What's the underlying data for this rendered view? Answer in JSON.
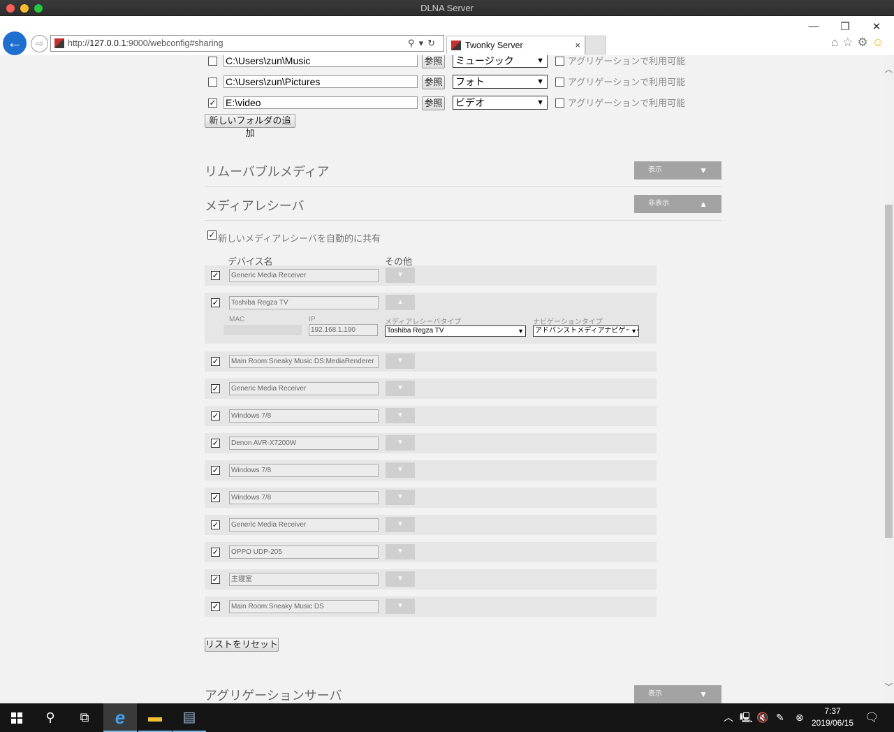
{
  "window": {
    "title": "DLNA Server"
  },
  "browser": {
    "url_prefix": "http://",
    "url_host": "127.0.0.1",
    "url_rest": ":9000/webconfig#sharing",
    "tab_title": "Twonky Server",
    "tab_close": "×",
    "win_min": "—",
    "win_restore": "❐",
    "win_close": "✕",
    "back_glyph": "←",
    "fwd_glyph": "⇨",
    "addr_icons": "⚲▾↻",
    "tool_home": "⌂",
    "tool_star": "☆",
    "tool_gear": "⚙",
    "tool_smile": "☺"
  },
  "folders": {
    "browse_label": "参照",
    "aggregation_label": "アグリゲーションで利用可能",
    "items": [
      {
        "path": "C:\\Users\\zun\\Music",
        "type": "ミュージック",
        "checked": ""
      },
      {
        "path": "C:\\Users\\zun\\Pictures",
        "type": "フォト",
        "checked": ""
      },
      {
        "path": "E:\\video",
        "type": "ビデオ",
        "checked": "✓"
      }
    ],
    "add_button": "新しいフォルダの追加",
    "select_arrow": "▼"
  },
  "removable": {
    "title": "リムーバブルメディア",
    "toggle": "表示",
    "toggle_arrow": "▼"
  },
  "receivers": {
    "title": "メディアレシーバ",
    "toggle": "非表示",
    "toggle_arrow": "▲",
    "auto_share_label": "新しいメディアレシーバを自動的に共有",
    "auto_share_check": "✓",
    "col_device": "デバイス名",
    "col_other": "その他",
    "row_check": "✓",
    "expand_arrow": "▼",
    "collapse_arrow": "▲",
    "devices": [
      "Generic Media Receiver",
      "Toshiba Regza TV",
      "Main Room:Sneaky Music DS:MediaRenderer",
      "Generic Media Receiver",
      "Windows 7/8",
      "Denon AVR-X7200W",
      "Windows 7/8",
      "Windows 7/8",
      "Generic Media Receiver",
      "OPPO UDP-205",
      "主寝室",
      "Main Room:Sneaky Music DS"
    ],
    "detail": {
      "mac_label": "MAC",
      "ip_label": "IP",
      "ip_value": "192.168.1.190",
      "receiver_type_label": "メディアレシーバタイプ",
      "receiver_type_value": "Toshiba Regza TV",
      "nav_type_label": "ナビゲーションタイプ",
      "nav_type_value": "アドバンストメディアナビゲーション",
      "small_arrow": "▼"
    },
    "reset_button": "リストをリセット"
  },
  "aggregation": {
    "title": "アグリゲーションサーバ",
    "toggle": "表示",
    "toggle_arrow": "▼"
  },
  "scroll": {
    "up": "︿",
    "down": "﹀"
  },
  "taskbar": {
    "search_glyph": "⚲",
    "taskview_glyph": "⧉",
    "ie_glyph": "e",
    "explorer_glyph": "▬",
    "server_glyph": "▤",
    "tray_chevron": "︿",
    "tray_network": "🖳",
    "tray_volume": "🔇",
    "tray_pen": "✎",
    "tray_x": "⊗",
    "tray_notify": "🗨",
    "time": "7:37",
    "date": "2019/06/15"
  },
  "colors": {
    "accent": "#1e6fd0",
    "toggle_bg": "#a3a3a3",
    "page_bg": "#f2f2f2"
  }
}
